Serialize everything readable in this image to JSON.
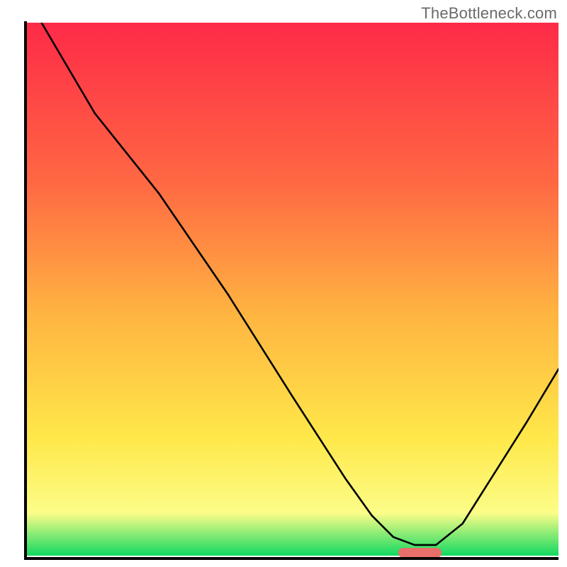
{
  "watermark": {
    "text": "TheBottleneck.com"
  },
  "colors": {
    "gradient_top": "#fe2a48",
    "gradient_mid1": "#ff6843",
    "gradient_mid2": "#ffb541",
    "gradient_mid3": "#ffe84a",
    "gradient_mid4": "#fcfd88",
    "gradient_bottom": "#12d961",
    "curve": "#000000",
    "marker": "#e86f6a",
    "axis": "#000000"
  },
  "chart_data": {
    "type": "line",
    "title": "",
    "xlabel": "",
    "ylabel": "",
    "xlim": [
      0,
      100
    ],
    "ylim": [
      0,
      100
    ],
    "marker": {
      "x_start": 70,
      "x_end": 78,
      "y": 1.3
    },
    "series": [
      {
        "name": "bottleneck-curve",
        "x": [
          3,
          13,
          25,
          38,
          50,
          60,
          65,
          69,
          73,
          77,
          82,
          88,
          94,
          100
        ],
        "y": [
          100,
          83,
          68,
          49,
          30,
          14.5,
          7.5,
          3.5,
          2,
          2,
          6,
          15.5,
          25,
          35
        ]
      }
    ],
    "grid": false,
    "legend": false
  }
}
